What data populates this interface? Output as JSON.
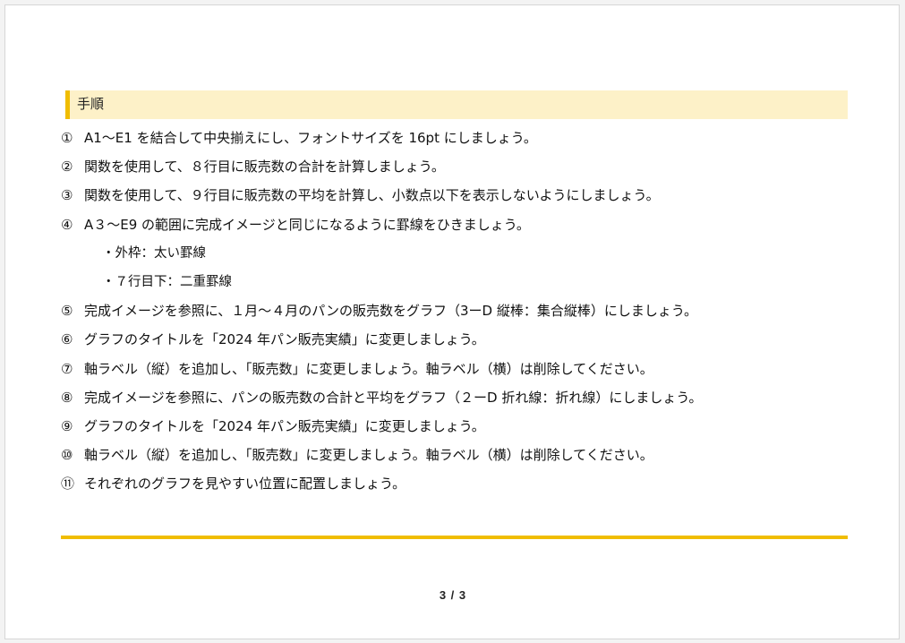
{
  "section": {
    "title": "手順"
  },
  "steps": [
    {
      "num": "①",
      "text": "A1～E1 を結合して中央揃えにし、フォントサイズを 16pt にしましょう。"
    },
    {
      "num": "②",
      "text": "関数を使用して、８行目に販売数の合計を計算しましょう。"
    },
    {
      "num": "③",
      "text": "関数を使用して、９行目に販売数の平均を計算し、小数点以下を表示しないようにしましょう。"
    },
    {
      "num": "④",
      "text": "A３～E9 の範囲に完成イメージと同じになるように罫線をひきましょう。"
    }
  ],
  "sub_items": [
    "・外枠：太い罫線",
    "・７行目下：二重罫線"
  ],
  "steps2": [
    {
      "num": "⑤",
      "text": "完成イメージを参照に、１月～４月のパンの販売数をグラフ（3ーD 縦棒：集合縦棒）にしましょう。"
    },
    {
      "num": "⑥",
      "text": "グラフのタイトルを「2024 年パン販売実績」に変更しましょう。"
    },
    {
      "num": "⑦",
      "text": "軸ラベル（縦）を追加し、「販売数」に変更しましょう。軸ラベル（横）は削除してください。"
    },
    {
      "num": "⑧",
      "text": "完成イメージを参照に、パンの販売数の合計と平均をグラフ（２ーD 折れ線：折れ線）にしましょう。"
    },
    {
      "num": "⑨",
      "text": "グラフのタイトルを「2024 年パン販売実績」に変更しましょう。"
    },
    {
      "num": "⑩",
      "text": "軸ラベル（縦）を追加し、「販売数」に変更しましょう。軸ラベル（横）は削除してください。"
    },
    {
      "num": "⑪",
      "text": "それぞれのグラフを見やすい位置に配置しましょう。"
    }
  ],
  "footer": {
    "page_number": "3 / 3"
  },
  "colors": {
    "accent": "#f0bd00",
    "header_bg": "#fdf1c8"
  }
}
